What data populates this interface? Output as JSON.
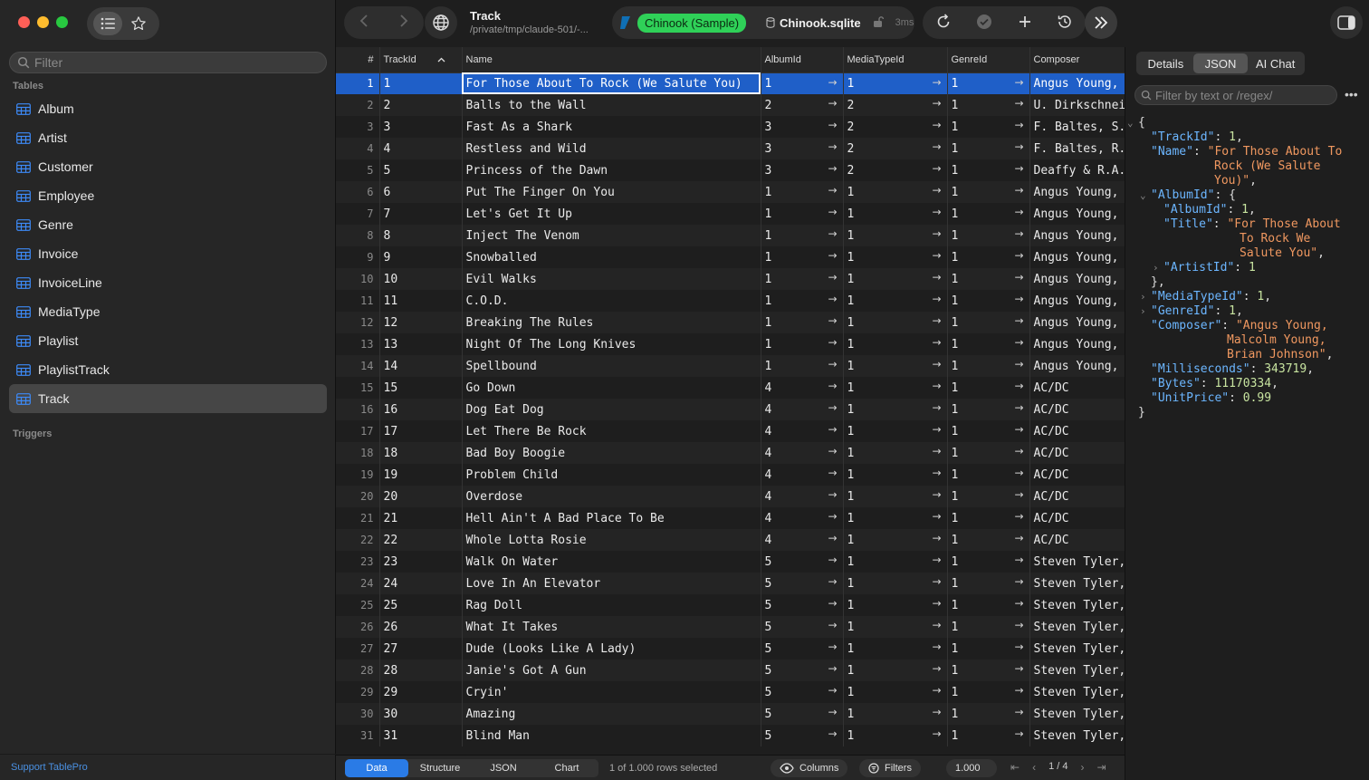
{
  "sidebar": {
    "filter_placeholder": "Filter",
    "tables_label": "Tables",
    "triggers_label": "Triggers",
    "tables": [
      "Album",
      "Artist",
      "Customer",
      "Employee",
      "Genre",
      "Invoice",
      "InvoiceLine",
      "MediaType",
      "Playlist",
      "PlaylistTrack",
      "Track"
    ],
    "selected_table": "Track",
    "support_link": "Support TablePro"
  },
  "toolbar": {
    "title": "Track",
    "path": "/private/tmp/claude-501/-...",
    "connection_badge": "Chinook (Sample)",
    "db_file": "Chinook.sqlite",
    "query_time": "3ms"
  },
  "grid": {
    "columns": [
      "#",
      "TrackId",
      "Name",
      "AlbumId",
      "MediaTypeId",
      "GenreId",
      "Composer"
    ],
    "sort_column": "TrackId",
    "rows": [
      [
        1,
        1,
        "For Those About To Rock (We Salute You)",
        1,
        1,
        1,
        "Angus Young,"
      ],
      [
        2,
        2,
        "Balls to the Wall",
        2,
        2,
        1,
        "U. Dirkschnei"
      ],
      [
        3,
        3,
        "Fast As a Shark",
        3,
        2,
        1,
        "F. Baltes, S."
      ],
      [
        4,
        4,
        "Restless and Wild",
        3,
        2,
        1,
        "F. Baltes, R."
      ],
      [
        5,
        5,
        "Princess of the Dawn",
        3,
        2,
        1,
        "Deaffy & R.A."
      ],
      [
        6,
        6,
        "Put The Finger On You",
        1,
        1,
        1,
        "Angus Young,"
      ],
      [
        7,
        7,
        "Let's Get It Up",
        1,
        1,
        1,
        "Angus Young,"
      ],
      [
        8,
        8,
        "Inject The Venom",
        1,
        1,
        1,
        "Angus Young,"
      ],
      [
        9,
        9,
        "Snowballed",
        1,
        1,
        1,
        "Angus Young,"
      ],
      [
        10,
        10,
        "Evil Walks",
        1,
        1,
        1,
        "Angus Young,"
      ],
      [
        11,
        11,
        "C.O.D.",
        1,
        1,
        1,
        "Angus Young,"
      ],
      [
        12,
        12,
        "Breaking The Rules",
        1,
        1,
        1,
        "Angus Young,"
      ],
      [
        13,
        13,
        "Night Of The Long Knives",
        1,
        1,
        1,
        "Angus Young,"
      ],
      [
        14,
        14,
        "Spellbound",
        1,
        1,
        1,
        "Angus Young,"
      ],
      [
        15,
        15,
        "Go Down",
        4,
        1,
        1,
        "AC/DC"
      ],
      [
        16,
        16,
        "Dog Eat Dog",
        4,
        1,
        1,
        "AC/DC"
      ],
      [
        17,
        17,
        "Let There Be Rock",
        4,
        1,
        1,
        "AC/DC"
      ],
      [
        18,
        18,
        "Bad Boy Boogie",
        4,
        1,
        1,
        "AC/DC"
      ],
      [
        19,
        19,
        "Problem Child",
        4,
        1,
        1,
        "AC/DC"
      ],
      [
        20,
        20,
        "Overdose",
        4,
        1,
        1,
        "AC/DC"
      ],
      [
        21,
        21,
        "Hell Ain't A Bad Place To Be",
        4,
        1,
        1,
        "AC/DC"
      ],
      [
        22,
        22,
        "Whole Lotta Rosie",
        4,
        1,
        1,
        "AC/DC"
      ],
      [
        23,
        23,
        "Walk On Water",
        5,
        1,
        1,
        "Steven Tyler,"
      ],
      [
        24,
        24,
        "Love In An Elevator",
        5,
        1,
        1,
        "Steven Tyler,"
      ],
      [
        25,
        25,
        "Rag Doll",
        5,
        1,
        1,
        "Steven Tyler,"
      ],
      [
        26,
        26,
        "What It Takes",
        5,
        1,
        1,
        "Steven Tyler,"
      ],
      [
        27,
        27,
        "Dude (Looks Like A Lady)",
        5,
        1,
        1,
        "Steven Tyler,"
      ],
      [
        28,
        28,
        "Janie's Got A Gun",
        5,
        1,
        1,
        "Steven Tyler,"
      ],
      [
        29,
        29,
        "Cryin'",
        5,
        1,
        1,
        "Steven Tyler,"
      ],
      [
        30,
        30,
        "Amazing",
        5,
        1,
        1,
        "Steven Tyler,"
      ],
      [
        31,
        31,
        "Blind Man",
        5,
        1,
        1,
        "Steven Tyler,"
      ]
    ],
    "selected_row": 1
  },
  "bottom": {
    "tabs": [
      "Data",
      "Structure",
      "JSON",
      "Chart"
    ],
    "active_tab": "Data",
    "rows_selected": "1 of 1.000 rows selected",
    "columns_label": "Columns",
    "filters_label": "Filters",
    "page_size": "1.000",
    "page_indicator": "1 / 4"
  },
  "right_panel": {
    "tabs": [
      "Details",
      "JSON",
      "AI Chat"
    ],
    "active_tab": "JSON",
    "filter_placeholder": "Filter by text or /regex/",
    "json_lines": [
      {
        "indent": 0,
        "caret": "down",
        "parts": [
          [
            "p",
            "{"
          ]
        ]
      },
      {
        "indent": 1,
        "parts": [
          [
            "k",
            "\"TrackId\""
          ],
          [
            "p",
            ": "
          ],
          [
            "n",
            "1"
          ],
          [
            "p",
            ","
          ]
        ]
      },
      {
        "indent": 1,
        "parts": [
          [
            "k",
            "\"Name\""
          ],
          [
            "p",
            ": "
          ],
          [
            "s",
            "\"For Those About To"
          ]
        ]
      },
      {
        "indent": 6,
        "parts": [
          [
            "s",
            "Rock (We Salute"
          ]
        ]
      },
      {
        "indent": 6,
        "parts": [
          [
            "s",
            "You)\""
          ],
          [
            "p",
            ","
          ]
        ]
      },
      {
        "indent": 1,
        "caret": "down",
        "parts": [
          [
            "k",
            "\"AlbumId\""
          ],
          [
            "p",
            ": {"
          ]
        ]
      },
      {
        "indent": 2,
        "parts": [
          [
            "k",
            "\"AlbumId\""
          ],
          [
            "p",
            ": "
          ],
          [
            "n",
            "1"
          ],
          [
            "p",
            ","
          ]
        ]
      },
      {
        "indent": 2,
        "parts": [
          [
            "k",
            "\"Title\""
          ],
          [
            "p",
            ": "
          ],
          [
            "s",
            "\"For Those About"
          ]
        ]
      },
      {
        "indent": 8,
        "parts": [
          [
            "s",
            "To Rock We"
          ]
        ]
      },
      {
        "indent": 8,
        "parts": [
          [
            "s",
            "Salute You\""
          ],
          [
            "p",
            ","
          ]
        ]
      },
      {
        "indent": 2,
        "caret": "right",
        "parts": [
          [
            "k",
            "\"ArtistId\""
          ],
          [
            "p",
            ": "
          ],
          [
            "n",
            "1"
          ]
        ]
      },
      {
        "indent": 1,
        "parts": [
          [
            "p",
            "},"
          ]
        ]
      },
      {
        "indent": 1,
        "caret": "right",
        "parts": [
          [
            "k",
            "\"MediaTypeId\""
          ],
          [
            "p",
            ": "
          ],
          [
            "n",
            "1"
          ],
          [
            "p",
            ","
          ]
        ]
      },
      {
        "indent": 1,
        "caret": "right",
        "parts": [
          [
            "k",
            "\"GenreId\""
          ],
          [
            "p",
            ": "
          ],
          [
            "n",
            "1"
          ],
          [
            "p",
            ","
          ]
        ]
      },
      {
        "indent": 1,
        "parts": [
          [
            "k",
            "\"Composer\""
          ],
          [
            "p",
            ": "
          ],
          [
            "s",
            "\"Angus Young,"
          ]
        ]
      },
      {
        "indent": 7,
        "parts": [
          [
            "s",
            "Malcolm Young,"
          ]
        ]
      },
      {
        "indent": 7,
        "parts": [
          [
            "s",
            "Brian Johnson\""
          ],
          [
            "p",
            ","
          ]
        ]
      },
      {
        "indent": 1,
        "parts": [
          [
            "k",
            "\"Milliseconds\""
          ],
          [
            "p",
            ": "
          ],
          [
            "n",
            "343719"
          ],
          [
            "p",
            ","
          ]
        ]
      },
      {
        "indent": 1,
        "parts": [
          [
            "k",
            "\"Bytes\""
          ],
          [
            "p",
            ": "
          ],
          [
            "n",
            "11170334"
          ],
          [
            "p",
            ","
          ]
        ]
      },
      {
        "indent": 1,
        "parts": [
          [
            "k",
            "\"UnitPrice\""
          ],
          [
            "p",
            ": "
          ],
          [
            "n",
            "0.99"
          ]
        ]
      },
      {
        "indent": 0,
        "parts": [
          [
            "p",
            "}"
          ]
        ]
      }
    ]
  },
  "colors": {
    "accent": "#2a7be6",
    "selection": "#1f5fc8",
    "connection_green": "#2fd158",
    "json_key": "#6cb6ff",
    "json_string": "#f09860",
    "json_number": "#c8e4a0"
  }
}
